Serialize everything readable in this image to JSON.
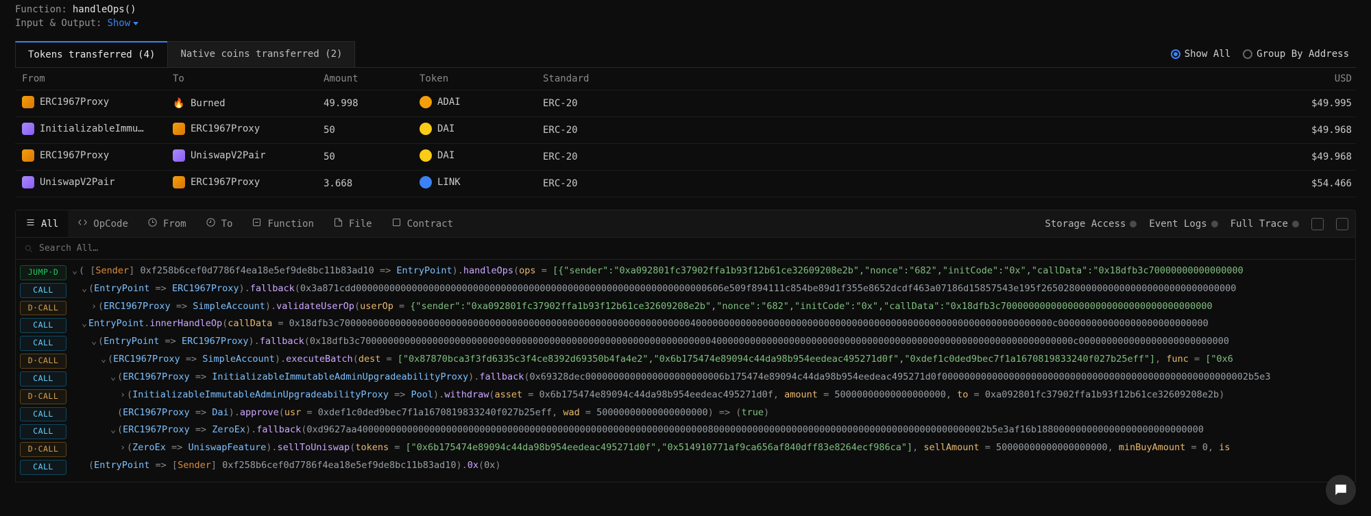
{
  "meta": {
    "function_label": "Function:",
    "function_value": "handleOps()",
    "io_label": "Input & Output:",
    "io_show": "Show"
  },
  "token_tabs": {
    "active": "Tokens transferred (4)",
    "inactive": "Native coins transferred (2)"
  },
  "radios": {
    "show_all": "Show All",
    "group_by": "Group By Address"
  },
  "columns": {
    "from": "From",
    "to": "To",
    "amount": "Amount",
    "token": "Token",
    "standard": "Standard",
    "usd": "USD"
  },
  "rows": [
    {
      "from_icon": "orange",
      "from": "ERC1967Proxy",
      "to_icon": "fire",
      "to": "Burned",
      "amount": "49.998",
      "tk_icon": "orange-circ",
      "token": "ADAI",
      "standard": "ERC-20",
      "usd": "$49.995"
    },
    {
      "from_icon": "purple",
      "from": "InitializableImmu…",
      "to_icon": "orange",
      "to": "ERC1967Proxy",
      "amount": "50",
      "tk_icon": "yellow-circ",
      "token": "DAI",
      "standard": "ERC-20",
      "usd": "$49.968"
    },
    {
      "from_icon": "orange",
      "from": "ERC1967Proxy",
      "to_icon": "purple",
      "to": "UniswapV2Pair",
      "amount": "50",
      "tk_icon": "yellow-circ",
      "token": "DAI",
      "standard": "ERC-20",
      "usd": "$49.968"
    },
    {
      "from_icon": "purple",
      "from": "UniswapV2Pair",
      "to_icon": "orange",
      "to": "ERC1967Proxy",
      "amount": "3.668",
      "tk_icon": "blue-circ",
      "token": "LINK",
      "standard": "ERC-20",
      "usd": "$54.466"
    }
  ],
  "filter_tabs": [
    "All",
    "OpCode",
    "From",
    "To",
    "Function",
    "File",
    "Contract"
  ],
  "right_tools": [
    "Storage Access",
    "Event Logs",
    "Full Trace"
  ],
  "search_placeholder": "Search All…",
  "trace": [
    {
      "pill": "JUMP·D",
      "depth": 0,
      "caret": "v",
      "segments": [
        {
          "t": "punc",
          "v": "( ["
        },
        {
          "t": "sender",
          "v": "Sender"
        },
        {
          "t": "punc",
          "v": "] "
        },
        {
          "t": "addr",
          "v": "0xf258b6cef0d7786f4ea18e5ef9de8bc11b83ad10"
        },
        {
          "t": "punc",
          "v": " => "
        },
        {
          "t": "contract",
          "v": "EntryPoint"
        },
        {
          "t": "punc",
          "v": ")."
        },
        {
          "t": "func",
          "v": "handleOps"
        },
        {
          "t": "punc",
          "v": "("
        },
        {
          "t": "param",
          "v": "ops"
        },
        {
          "t": "punc",
          "v": " = "
        },
        {
          "t": "lit",
          "v": "[{\"sender\":\"0xa092801fc37902ffa1b93f12b61ce32609208e2b\",\"nonce\":\"682\",\"initCode\":\"0x\",\"callData\":\"0x18dfb3c70000000000000000"
        }
      ]
    },
    {
      "pill": "CALL",
      "depth": 1,
      "caret": "v",
      "segments": [
        {
          "t": "punc",
          "v": "("
        },
        {
          "t": "contract",
          "v": "EntryPoint"
        },
        {
          "t": "punc",
          "v": " => "
        },
        {
          "t": "contract",
          "v": "ERC1967Proxy"
        },
        {
          "t": "punc",
          "v": ")."
        },
        {
          "t": "func",
          "v": "fallback"
        },
        {
          "t": "punc",
          "v": "("
        },
        {
          "t": "addr",
          "v": "0x3a871cdd000000000000000000000000000000000000000000000000000000000000000606e509f894111c854be89d1f355e8652dcdf463a07186d15857543e195f26502800000000000000000000000000000"
        }
      ]
    },
    {
      "pill": "D·CALL",
      "depth": 2,
      "caret": ">",
      "segments": [
        {
          "t": "punc",
          "v": "("
        },
        {
          "t": "contract",
          "v": "ERC1967Proxy"
        },
        {
          "t": "punc",
          "v": " => "
        },
        {
          "t": "contract",
          "v": "SimpleAccount"
        },
        {
          "t": "punc",
          "v": ")."
        },
        {
          "t": "func",
          "v": "validateUserOp"
        },
        {
          "t": "punc",
          "v": "("
        },
        {
          "t": "param",
          "v": "userOp"
        },
        {
          "t": "punc",
          "v": " = "
        },
        {
          "t": "lit",
          "v": "{\"sender\":\"0xa092801fc37902ffa1b93f12b61ce32609208e2b\",\"nonce\":\"682\",\"initCode\":\"0x\",\"callData\":\"0x18dfb3c70000000000000000000000000000000000000"
        }
      ]
    },
    {
      "pill": "CALL",
      "depth": 1,
      "caret": "v",
      "segments": [
        {
          "t": "contract",
          "v": "EntryPoint"
        },
        {
          "t": "punc",
          "v": "."
        },
        {
          "t": "func",
          "v": "innerHandleOp"
        },
        {
          "t": "punc",
          "v": "("
        },
        {
          "t": "param",
          "v": "callData"
        },
        {
          "t": "punc",
          "v": " = "
        },
        {
          "t": "addr",
          "v": "0x18dfb3c70000000000000000000000000000000000000000000000000000000000000040000000000000000000000000000000000000000000000000000000000000000c000000000000000000000000000"
        }
      ]
    },
    {
      "pill": "CALL",
      "depth": 2,
      "caret": "v",
      "segments": [
        {
          "t": "punc",
          "v": "("
        },
        {
          "t": "contract",
          "v": "EntryPoint"
        },
        {
          "t": "punc",
          "v": " => "
        },
        {
          "t": "contract",
          "v": "ERC1967Proxy"
        },
        {
          "t": "punc",
          "v": ")."
        },
        {
          "t": "func",
          "v": "fallback"
        },
        {
          "t": "punc",
          "v": "("
        },
        {
          "t": "addr",
          "v": "0x18dfb3c70000000000000000000000000000000000000000000000000000000000000040000000000000000000000000000000000000000000000000000000000000000c000000000000000000000000000"
        }
      ]
    },
    {
      "pill": "D·CALL",
      "depth": 3,
      "caret": "v",
      "segments": [
        {
          "t": "punc",
          "v": "("
        },
        {
          "t": "contract",
          "v": "ERC1967Proxy"
        },
        {
          "t": "punc",
          "v": " => "
        },
        {
          "t": "contract",
          "v": "SimpleAccount"
        },
        {
          "t": "punc",
          "v": ")."
        },
        {
          "t": "func",
          "v": "executeBatch"
        },
        {
          "t": "punc",
          "v": "("
        },
        {
          "t": "param",
          "v": "dest"
        },
        {
          "t": "punc",
          "v": " = "
        },
        {
          "t": "lit",
          "v": "[\"0x87870bca3f3fd6335c3f4ce8392d69350b4fa4e2\",\"0x6b175474e89094c44da98b954eedeac495271d0f\",\"0xdef1c0ded9bec7f1a1670819833240f027b25eff\"]"
        },
        {
          "t": "punc",
          "v": ", "
        },
        {
          "t": "param",
          "v": "func"
        },
        {
          "t": "punc",
          "v": " = "
        },
        {
          "t": "lit",
          "v": "[\"0x6"
        }
      ]
    },
    {
      "pill": "CALL",
      "depth": 4,
      "caret": "v",
      "segments": [
        {
          "t": "punc",
          "v": "("
        },
        {
          "t": "contract",
          "v": "ERC1967Proxy"
        },
        {
          "t": "punc",
          "v": " => "
        },
        {
          "t": "contract",
          "v": "InitializableImmutableAdminUpgradeabilityProxy"
        },
        {
          "t": "punc",
          "v": ")."
        },
        {
          "t": "func",
          "v": "fallback"
        },
        {
          "t": "punc",
          "v": "("
        },
        {
          "t": "addr",
          "v": "0x69328dec0000000000000000000000006b175474e89094c44da98b954eedeac495271d0f0000000000000000000000000000000000000000000000000000002b5e3"
        }
      ]
    },
    {
      "pill": "D·CALL",
      "depth": 5,
      "caret": ">",
      "segments": [
        {
          "t": "punc",
          "v": "("
        },
        {
          "t": "contract",
          "v": "InitializableImmutableAdminUpgradeabilityProxy"
        },
        {
          "t": "punc",
          "v": " => "
        },
        {
          "t": "contract",
          "v": "Pool"
        },
        {
          "t": "punc",
          "v": ")."
        },
        {
          "t": "func",
          "v": "withdraw"
        },
        {
          "t": "punc",
          "v": "("
        },
        {
          "t": "param",
          "v": "asset"
        },
        {
          "t": "punc",
          "v": " = "
        },
        {
          "t": "addr",
          "v": "0x6b175474e89094c44da98b954eedeac495271d0f"
        },
        {
          "t": "punc",
          "v": ", "
        },
        {
          "t": "param",
          "v": "amount"
        },
        {
          "t": "punc",
          "v": " = "
        },
        {
          "t": "addr",
          "v": "50000000000000000000"
        },
        {
          "t": "punc",
          "v": ", "
        },
        {
          "t": "param",
          "v": "to"
        },
        {
          "t": "punc",
          "v": " = "
        },
        {
          "t": "addr",
          "v": "0xa092801fc37902ffa1b93f12b61ce32609208e2b"
        },
        {
          "t": "punc",
          "v": ")"
        }
      ]
    },
    {
      "pill": "CALL",
      "depth": 4,
      "caret": "",
      "segments": [
        {
          "t": "punc",
          "v": "("
        },
        {
          "t": "contract",
          "v": "ERC1967Proxy"
        },
        {
          "t": "punc",
          "v": " => "
        },
        {
          "t": "contract",
          "v": "Dai"
        },
        {
          "t": "punc",
          "v": ")."
        },
        {
          "t": "func",
          "v": "approve"
        },
        {
          "t": "punc",
          "v": "("
        },
        {
          "t": "param",
          "v": "usr"
        },
        {
          "t": "punc",
          "v": " = "
        },
        {
          "t": "addr",
          "v": "0xdef1c0ded9bec7f1a1670819833240f027b25eff"
        },
        {
          "t": "punc",
          "v": ", "
        },
        {
          "t": "param",
          "v": "wad"
        },
        {
          "t": "punc",
          "v": " = "
        },
        {
          "t": "addr",
          "v": "50000000000000000000"
        },
        {
          "t": "punc",
          "v": ") => ("
        },
        {
          "t": "lit",
          "v": "true"
        },
        {
          "t": "punc",
          "v": ")"
        }
      ]
    },
    {
      "pill": "CALL",
      "depth": 4,
      "caret": "v",
      "segments": [
        {
          "t": "punc",
          "v": "("
        },
        {
          "t": "contract",
          "v": "ERC1967Proxy"
        },
        {
          "t": "punc",
          "v": " => "
        },
        {
          "t": "contract",
          "v": "ZeroEx"
        },
        {
          "t": "punc",
          "v": ")."
        },
        {
          "t": "func",
          "v": "fallback"
        },
        {
          "t": "punc",
          "v": "("
        },
        {
          "t": "addr",
          "v": "0xd9627aa40000000000000000000000000000000000000000000000000000000000000080000000000000000000000000000000000000000000000002b5e3af16b188000000000000000000000000000"
        }
      ]
    },
    {
      "pill": "D·CALL",
      "depth": 5,
      "caret": ">",
      "segments": [
        {
          "t": "punc",
          "v": "("
        },
        {
          "t": "contract",
          "v": "ZeroEx"
        },
        {
          "t": "punc",
          "v": " => "
        },
        {
          "t": "contract",
          "v": "UniswapFeature"
        },
        {
          "t": "punc",
          "v": ")."
        },
        {
          "t": "func",
          "v": "sellToUniswap"
        },
        {
          "t": "punc",
          "v": "("
        },
        {
          "t": "param",
          "v": "tokens"
        },
        {
          "t": "punc",
          "v": " = "
        },
        {
          "t": "lit",
          "v": "[\"0x6b175474e89094c44da98b954eedeac495271d0f\",\"0x514910771af9ca656af840dff83e8264ecf986ca\"]"
        },
        {
          "t": "punc",
          "v": ", "
        },
        {
          "t": "param",
          "v": "sellAmount"
        },
        {
          "t": "punc",
          "v": " = "
        },
        {
          "t": "addr",
          "v": "50000000000000000000"
        },
        {
          "t": "punc",
          "v": ", "
        },
        {
          "t": "param",
          "v": "minBuyAmount"
        },
        {
          "t": "punc",
          "v": " = "
        },
        {
          "t": "addr",
          "v": "0"
        },
        {
          "t": "punc",
          "v": ", "
        },
        {
          "t": "param",
          "v": "is"
        }
      ]
    },
    {
      "pill": "CALL",
      "depth": 1,
      "caret": "",
      "segments": [
        {
          "t": "punc",
          "v": "("
        },
        {
          "t": "contract",
          "v": "EntryPoint"
        },
        {
          "t": "punc",
          "v": " => ["
        },
        {
          "t": "sender",
          "v": "Sender"
        },
        {
          "t": "punc",
          "v": "] "
        },
        {
          "t": "addr",
          "v": "0xf258b6cef0d7786f4ea18e5ef9de8bc11b83ad10"
        },
        {
          "t": "punc",
          "v": ")."
        },
        {
          "t": "func",
          "v": "0x"
        },
        {
          "t": "punc",
          "v": "("
        },
        {
          "t": "addr",
          "v": "0x"
        },
        {
          "t": "punc",
          "v": ")"
        }
      ]
    }
  ]
}
